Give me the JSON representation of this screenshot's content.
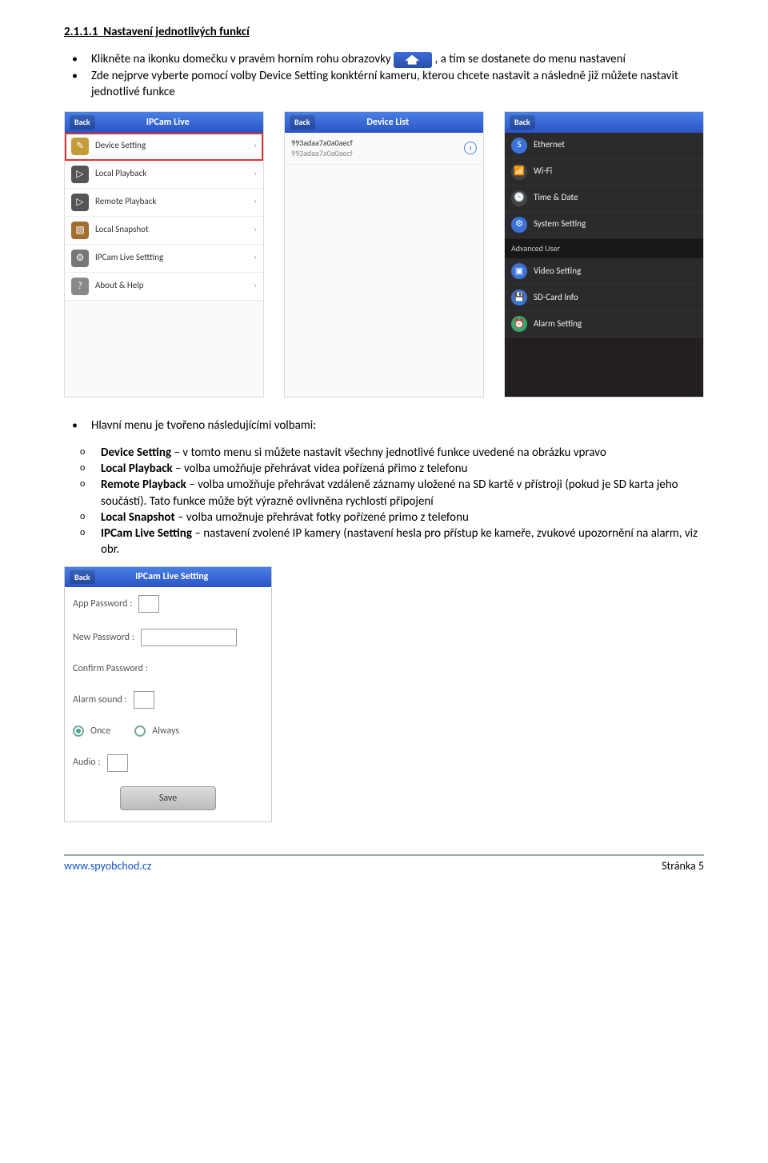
{
  "heading_num": "2.1.1.1",
  "heading_text": "Nastavení jednotlivých funkcí",
  "bullet1_a": "Klikněte na ikonku domečku v pravém horním rohu obrazovky ",
  "bullet1_b": ", a tím se dostanete do menu nastavení",
  "bullet2": "Zde nejprve vyberte pomocí volby Device Setting konktérní kameru, kterou chcete nastavit a následně již můžete nastavit jednotlivé funkce",
  "screen1": {
    "back": "Back",
    "title": "IPCam Live",
    "items": [
      {
        "label": "Device Setting",
        "icon_bg": "#c59b39",
        "icon": "✎"
      },
      {
        "label": "Local Playback",
        "icon_bg": "#555",
        "icon": "▷"
      },
      {
        "label": "Remote Playback",
        "icon_bg": "#555",
        "icon": "▷"
      },
      {
        "label": "Local Snapshot",
        "icon_bg": "#a26b2f",
        "icon": "🖼"
      },
      {
        "label": "IPCam Live Settting",
        "icon_bg": "#777",
        "icon": "⚙"
      },
      {
        "label": "About & Help",
        "icon_bg": "#888",
        "icon": "?"
      }
    ]
  },
  "screen2": {
    "back": "Back",
    "title": "Device List",
    "dev1": "993adaa7a0a0aecf",
    "dev2": "993adaa7a0a0aecf"
  },
  "screen3": {
    "back": "Back",
    "basic": [
      {
        "label": "Ethernet",
        "icon_bg": "#3a72d8",
        "icon": "S"
      },
      {
        "label": "Wi-Fi",
        "icon_bg": "#444",
        "icon": "📶"
      },
      {
        "label": "Time & Date",
        "icon_bg": "#444",
        "icon": "🕒"
      },
      {
        "label": "System Setting",
        "icon_bg": "#3a72d8",
        "icon": "⚙"
      }
    ],
    "adv_label": "Advanced User",
    "adv": [
      {
        "label": "Video Setting",
        "icon_bg": "#3a72d8",
        "icon": "▣"
      },
      {
        "label": "SD-Card Info",
        "icon_bg": "#3a72d8",
        "icon": "💾"
      },
      {
        "label": "Alarm Setting",
        "icon_bg": "#3aa36a",
        "icon": "⏰"
      }
    ]
  },
  "mid_bullet": "Hlavní menu je tvořeno následujícími volbami:",
  "sub": {
    "a_bold": "Device Setting",
    "a_rest": " – v tomto menu si můžete nastavit všechny jednotlivé funkce uvedené na obrázku vpravo",
    "b_bold": "Local Playback",
    "b_rest": " – volba umožňuje přehrávat videa pořízená přimo z telefonu",
    "c_bold": "Remote Playback",
    "c_rest": " – volba umožňuje přehrávat vzdáleně záznamy uložené na SD kartě v přístroji (pokud je SD karta jeho součástí). Tato funkce může být výrazně ovlivněna rychlostí připojení",
    "d_bold": "Local Snapshot",
    "d_rest": " – volba umožnuje přehrávat fotky pořízené primo z telefonu",
    "e_bold": "IPCam Live Setting",
    "e_rest": " – nastavení zvolené IP kamery  (nastavení hesla pro přístup ke kameře, zvukové upozornění na alarm, viz obr."
  },
  "settings_panel": {
    "back": "Back",
    "title": "IPCam Live Setting",
    "app_pw": "App Password :",
    "new_pw": "New Password :",
    "conf_pw": "Confirm Password :",
    "alarm": "Alarm sound :",
    "once": "Once",
    "always": "Always",
    "audio": "Audio :",
    "save": "Save"
  },
  "footer": {
    "url": "www.spyobchod.cz",
    "page": "Stránka 5"
  }
}
